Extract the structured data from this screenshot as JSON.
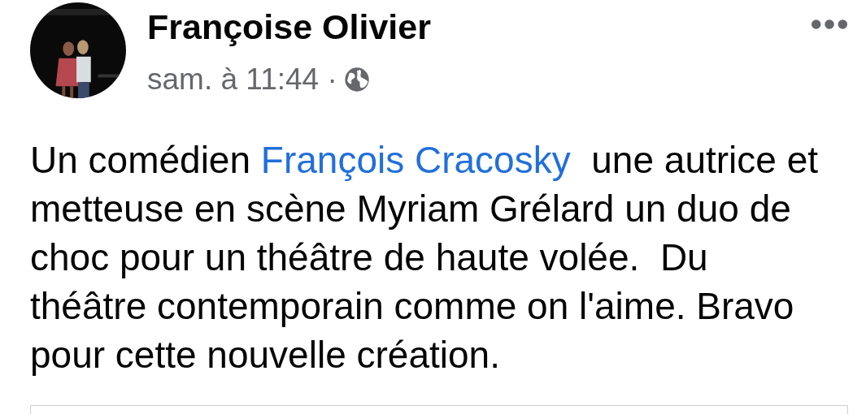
{
  "post": {
    "author": "Françoise Olivier",
    "time": "sam. à 11:44 ·",
    "body": [
      [
        {
          "kind": "plain",
          "text": "Un comédien "
        },
        {
          "kind": "link",
          "text": "François Cracosky"
        },
        {
          "kind": "plain",
          "text": "  une autrice et"
        }
      ],
      [
        {
          "kind": "plain",
          "text": "metteuse en scène Myriam Grélard un duo de"
        }
      ],
      [
        {
          "kind": "plain",
          "text": "choc pour un théâtre de haute volée.  Du"
        }
      ],
      [
        {
          "kind": "plain",
          "text": "théâtre contemporain comme on l'aime. Bravo"
        }
      ],
      [
        {
          "kind": "plain",
          "text": "pour cette nouvelle création."
        }
      ]
    ]
  }
}
